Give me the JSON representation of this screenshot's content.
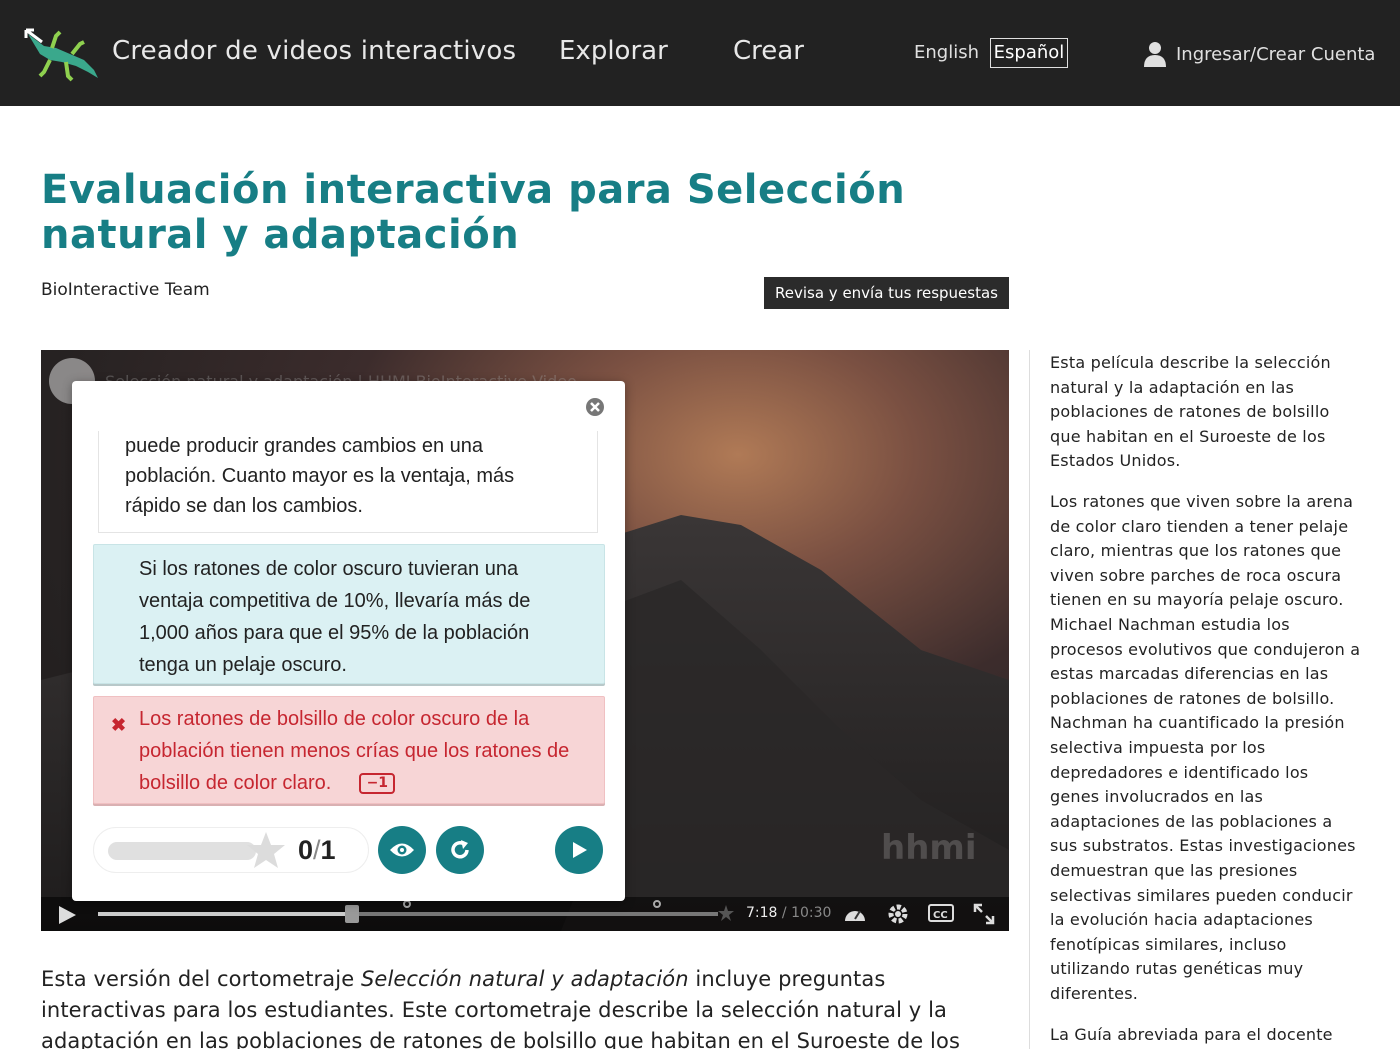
{
  "header": {
    "brand": "Creador de videos interactivos",
    "nav": [
      "Explorar",
      "Crear"
    ],
    "lang_english": "English",
    "lang_espanol": "Español",
    "login": "Ingresar/Crear Cuenta"
  },
  "page": {
    "title": "Evaluación interactiva para Selección natural y adaptación",
    "author": "BioInteractive Team",
    "submit_label": "Revisa y envía tus respuestas"
  },
  "video": {
    "title": "Selección natural y adaptación | HHMI BioInteractive Video",
    "watermark": "hhmi",
    "current_time": "7:18",
    "duration": " / 10:30",
    "progress": 0.41
  },
  "quiz": {
    "prev_option_lines": [
      "puede producir grandes cambios en una",
      "población. Cuanto mayor es la ventaja, más",
      "rápido se dan los cambios."
    ],
    "correct_option": "Si los ratones de color oscuro tuvieran una ventaja competitiva de 10%, llevaría más de 1,000 años para que el 95% de la población tenga un pelaje oscuro.",
    "wrong_option": "Los ratones de bolsillo de color oscuro de la población tienen menos crías que los ratones de bolsillo de color claro.",
    "penalty": "−1",
    "score": "0",
    "score_max": "1"
  },
  "sidebar": {
    "p1": "Esta película describe la selección natural y la adaptación en las poblaciones de ratones de bolsillo que habitan en el Suroeste de los Estados Unidos.",
    "p2": "Los ratones que viven sobre la arena de color claro tienden a tener pelaje claro, mientras que los ratones que viven sobre parches de roca oscura tienen en su mayoría pelaje oscuro. Michael Nachman estudia los procesos evolutivos que condujeron a estas marcadas diferencias en las poblaciones de ratones de bolsillo. Nachman ha cuantificado la presión selectiva impuesta por los depredadores e identificado los genes involucrados en las adaptaciones de las poblaciones a sus substratos. Estas investigaciones demuestran que las presiones selectivas similares pueden conducir la evolución hacia adaptaciones fenotípicas similares, incluso utilizando rutas genéticas muy diferentes.",
    "p3": "La Guía abreviada para el docente"
  },
  "description": {
    "before": "Esta versión del cortometraje ",
    "film_title": "Selección natural y adaptación",
    "after": " incluye preguntas interactivas para los estudiantes. Este cortometraje describe la selección natural y la adaptación en las poblaciones de ratones de bolsillo que habitan en el Suroeste de los Estados Unidos."
  },
  "colors": {
    "accent": "#177e85",
    "wrong": "#c62630",
    "correct_bg": "#dbf1f3",
    "wrong_bg": "#f7d5d6"
  }
}
